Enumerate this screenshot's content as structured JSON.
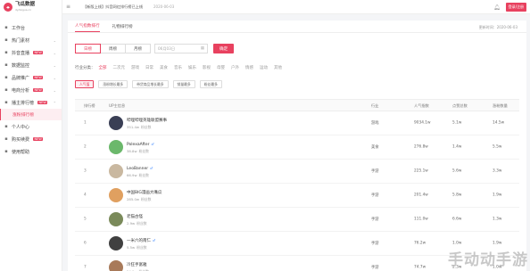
{
  "brand": {
    "name": "飞瓜数据",
    "subtitle": "dy.feigua.cn"
  },
  "topbar": {
    "announcement": "【新版上线】抖音网红排行榜已上线",
    "date": "2020-06-03",
    "login_label": "登录/注册"
  },
  "sidebar": {
    "items": [
      {
        "label": "工作台",
        "icon": "home-icon",
        "arrow": ""
      },
      {
        "label": "热门素材",
        "icon": "fire-icon",
        "arrow": "⌄"
      },
      {
        "label": "抖音直播",
        "icon": "live-icon",
        "arrow": "⌄",
        "tag": "NEW"
      },
      {
        "label": "数据监控",
        "icon": "monitor-icon",
        "arrow": "⌄"
      },
      {
        "label": "品牌推广",
        "icon": "brand-icon",
        "arrow": "⌄",
        "tag": "NEW"
      },
      {
        "label": "电商分析",
        "icon": "cart-icon",
        "arrow": "⌄",
        "tag": "NEW"
      },
      {
        "label": "播主排行榜",
        "icon": "rank-icon",
        "arrow": "⌃",
        "tag": "NEW"
      }
    ],
    "sub_active": "涨粉排行榜",
    "items_after": [
      {
        "label": "个人中心",
        "icon": "user-icon",
        "arrow": ""
      },
      {
        "label": "购买续费",
        "icon": "pay-icon",
        "arrow": "",
        "tag": "NEW"
      },
      {
        "label": "使用帮助",
        "icon": "help-icon",
        "arrow": ""
      }
    ]
  },
  "tabs": [
    {
      "label": "人气指数排行",
      "active": true
    },
    {
      "label": "礼物排行榜",
      "active": false
    }
  ],
  "update_time": "更新时间：2020-06-03",
  "period": [
    {
      "label": "日榜",
      "active": true
    },
    {
      "label": "周榜",
      "active": false
    },
    {
      "label": "月榜",
      "active": false
    }
  ],
  "date_value": "06月03日",
  "confirm_label": "确定",
  "filter": {
    "label": "行业分类：",
    "categories": [
      {
        "label": "全部",
        "active": true
      },
      {
        "label": "二次元",
        "active": false
      },
      {
        "label": "游戏",
        "active": false
      },
      {
        "label": "日常",
        "active": false
      },
      {
        "label": "美食",
        "active": false
      },
      {
        "label": "音乐",
        "active": false
      },
      {
        "label": "娱乐",
        "active": false
      },
      {
        "label": "影视",
        "active": false
      },
      {
        "label": "母婴",
        "active": false
      },
      {
        "label": "户外",
        "active": false
      },
      {
        "label": "情感",
        "active": false
      },
      {
        "label": "运动",
        "active": false
      },
      {
        "label": "其他",
        "active": false
      }
    ]
  },
  "sorts": [
    {
      "label": "人气值",
      "active": true
    },
    {
      "label": "涨粉增长最多",
      "active": false
    },
    {
      "label": "带货商品增长最多",
      "active": false
    },
    {
      "label": "销量最多",
      "active": false
    },
    {
      "label": "粉丝最多",
      "active": false
    }
  ],
  "columns": {
    "rank": "排行榜",
    "up": "UP主信息",
    "industry": "行业",
    "pop": "人气指数",
    "likes": "点赞总数",
    "gain": "涨粉数量"
  },
  "rows": [
    {
      "rank": "1",
      "name": "哔哩哔哩英雄联盟赛事",
      "fans": "351.4w",
      "fans_label": "粉丝数",
      "verified": false,
      "industry": "游戏",
      "pop": "9034.1w",
      "likes": "5.1w",
      "gain": "14.5w",
      "avatar_color": "#3a3f55"
    },
    {
      "rank": "2",
      "name": "PolexaAfter",
      "fans": "38.8w",
      "fans_label": "粉丝数",
      "verified": true,
      "industry": "美食",
      "pop": "276.8w",
      "likes": "1.4w",
      "gain": "5.5w",
      "avatar_color": "#6bb86b"
    },
    {
      "rank": "3",
      "name": "LeoBanner",
      "fans": "66.9w",
      "fans_label": "粉丝数",
      "verified": true,
      "industry": "手游",
      "pop": "225.1w",
      "likes": "5.6w",
      "gain": "3.3w",
      "avatar_color": "#c9b8a0"
    },
    {
      "rank": "4",
      "name": "中国BIG漫画大嘴瓜",
      "fans": "285.0w",
      "fans_label": "粉丝数",
      "verified": false,
      "industry": "手游",
      "pop": "201.4w",
      "likes": "5.8w",
      "gain": "1.9w",
      "avatar_color": "#e0a060"
    },
    {
      "rank": "5",
      "name": "老猫古怪",
      "fans": "2.9w",
      "fans_label": "粉丝数",
      "verified": false,
      "industry": "手游",
      "pop": "111.0w",
      "likes": "6.6w",
      "gain": "1.3w",
      "avatar_color": "#7a8a5a"
    },
    {
      "rank": "6",
      "name": "一米六的南仁",
      "fans": "5.5w",
      "fans_label": "粉丝数",
      "verified": true,
      "industry": "手游",
      "pop": "76.2w",
      "likes": "1.0w",
      "gain": "1.9w",
      "avatar_color": "#404040"
    },
    {
      "rank": "7",
      "name": "冷狂手富雅",
      "fans": "54.9w",
      "fans_label": "粉丝数",
      "verified": false,
      "industry": "手游",
      "pop": "74.7w",
      "likes": "2.3w",
      "gain": "1.0w",
      "avatar_color": "#a87a5a"
    }
  ],
  "watermark": "手动动手游"
}
